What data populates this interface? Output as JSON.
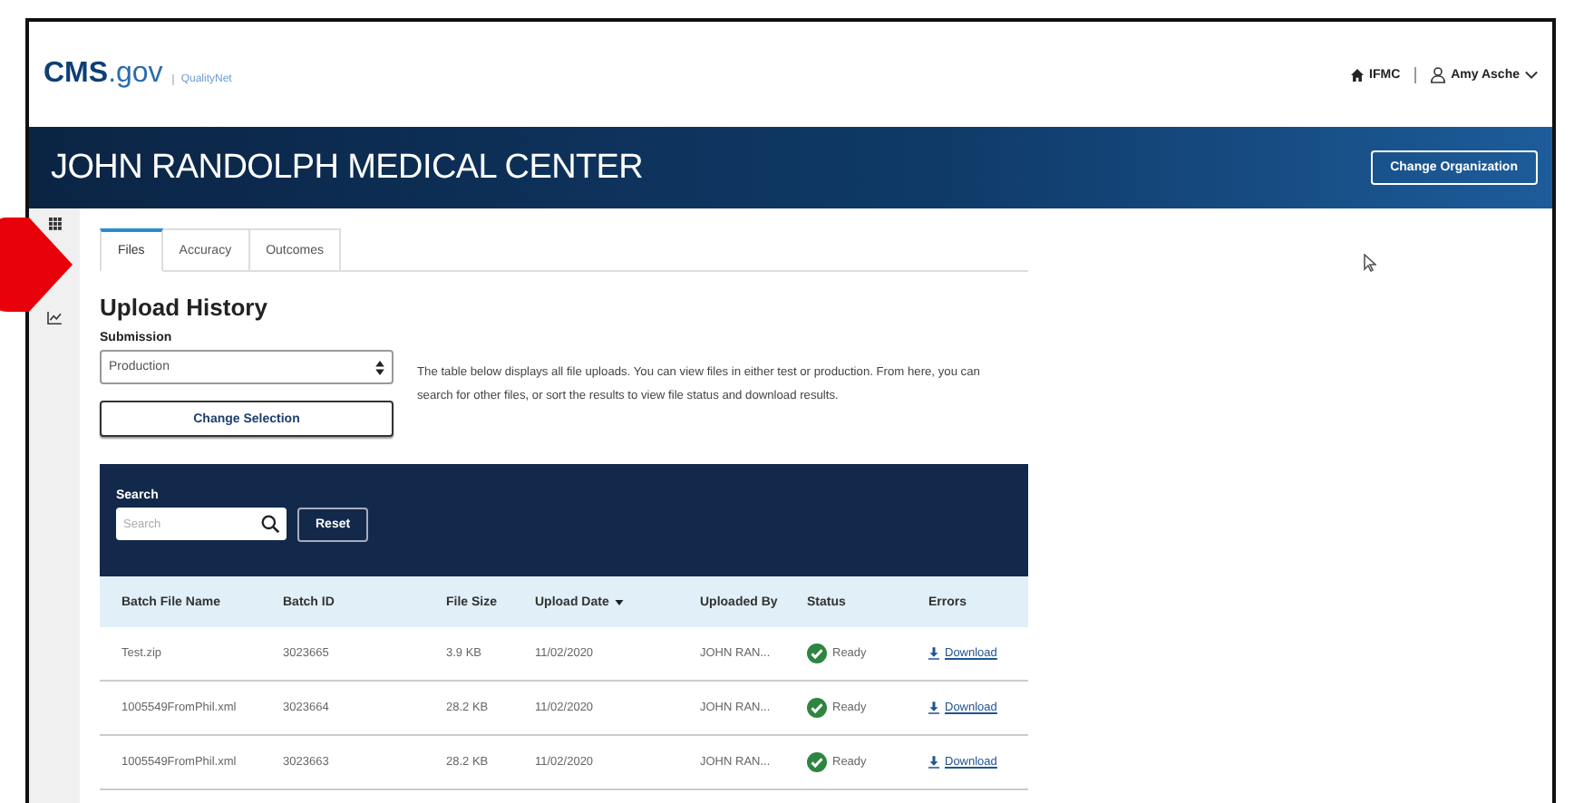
{
  "header": {
    "logo": "**CMS**.gov",
    "logo_sub": "QualityNet",
    "org_link": "IFMC",
    "user": "Amy Asche"
  },
  "banner": {
    "title": "JOHN RANDOLPH MEDICAL CENTER",
    "button": "Change Organization"
  },
  "tabs": [
    {
      "label": "Files",
      "selected": true
    },
    {
      "label": "Accuracy",
      "selected": false
    },
    {
      "label": "Outcomes",
      "selected": false
    }
  ],
  "heading": "Upload History",
  "submission": {
    "label": "Submission",
    "value": "Production"
  },
  "description": "The table below displays all file uploads. You can view files in either test or production. From here, you can search for other files, or sort the results to view file status and download results.",
  "change_button": "Change Selection",
  "search": {
    "label": "Search",
    "placeholder": "Search",
    "reset": "Reset"
  },
  "table": {
    "columns": [
      {
        "label": "Batch File Name",
        "sorted": false
      },
      {
        "label": "Batch ID",
        "sorted": false
      },
      {
        "label": "File Size",
        "sorted": false
      },
      {
        "label": "Upload Date",
        "sorted": true
      },
      {
        "label": "Uploaded By",
        "sorted": false
      },
      {
        "label": "Status",
        "sorted": false
      },
      {
        "label": "Errors",
        "sorted": false
      }
    ],
    "rows": [
      {
        "name": "Test.zip",
        "batch_id": "3023665",
        "size": "3.9 KB",
        "date": "11/02/2020",
        "by": "JOHN RAN...",
        "status": {
          "kind": "check",
          "text": "Ready"
        },
        "errors": "Download"
      },
      {
        "name": "1005549FromPhil.xml",
        "batch_id": "3023664",
        "size": "28.2 KB",
        "date": "11/02/2020",
        "by": "JOHN RAN...",
        "status": {
          "kind": "check",
          "text": "Ready"
        },
        "errors": "Download"
      },
      {
        "name": "1005549FromPhil.xml",
        "batch_id": "3023663",
        "size": "28.2 KB",
        "date": "11/02/2020",
        "by": "JOHN RAN...",
        "status": {
          "kind": "check",
          "text": "Ready"
        },
        "errors": "Download"
      }
    ]
  }
}
